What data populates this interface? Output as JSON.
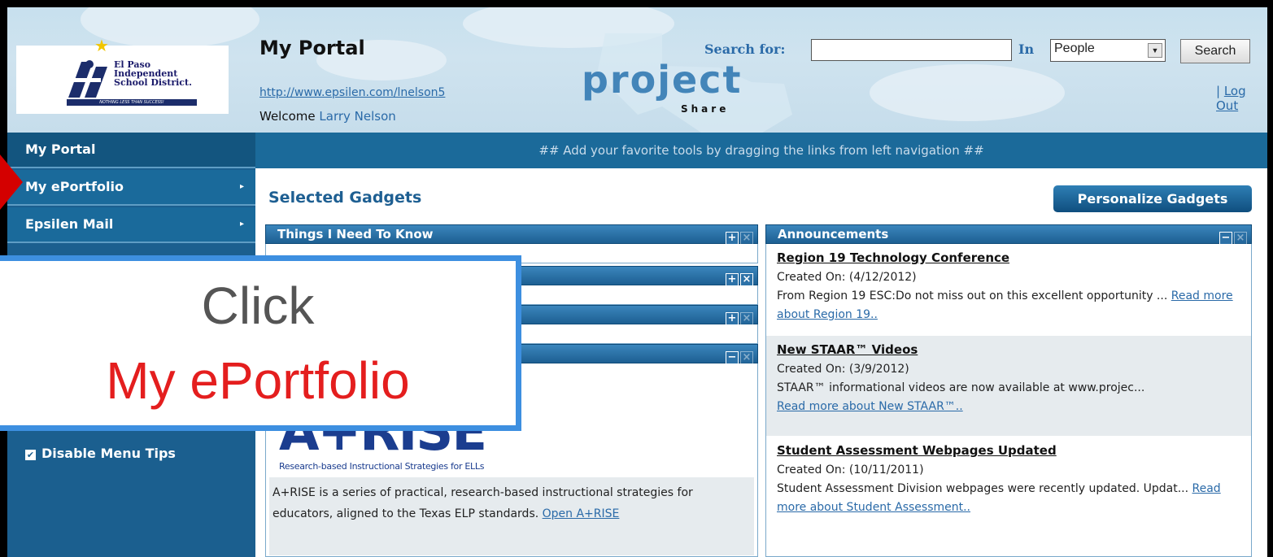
{
  "header": {
    "logo_lines": [
      "El Paso",
      "Independent",
      "School District."
    ],
    "logo_tagline": "NOTHING LESS THAN SUCCESS!",
    "title": "My Portal",
    "url": "http://www.epsilen.com/lnelson5",
    "welcome_prefix": "Welcome",
    "welcome_name": "Larry Nelson",
    "brand_word": "project",
    "brand_sub": "Share",
    "search_label": "Search for:",
    "search_value": "",
    "in_label": "In",
    "scope_selected": "People",
    "search_button": "Search",
    "logout_sep": "|",
    "logout": "Log Out"
  },
  "sidebar": {
    "items": [
      {
        "label": "My Portal"
      },
      {
        "label": "My ePortfolio"
      },
      {
        "label": "Epsilen Mail"
      }
    ],
    "disable_tips": "Disable Menu Tips"
  },
  "main": {
    "drag_hint": "## Add your favorite tools by dragging the links from left navigation ##",
    "selected_gadgets": "Selected Gadgets",
    "personalize_button": "Personalize Gadgets",
    "gadgets": [
      {
        "title": "Things I Need To Know"
      }
    ],
    "arise": {
      "logo": "A+RISE",
      "subtitle": "Research-based Instructional Strategies for ELLs",
      "desc": "A+RISE is a series of practical, research-based instructional strategies for educators, aligned to the Texas ELP standards.",
      "link": "Open A+RISE"
    },
    "announcements": {
      "title": "Announcements",
      "items": [
        {
          "title": "Region 19 Technology Conference",
          "created": "Created On: (4/12/2012)",
          "text": "From Region 19 ESC:Do not miss out on this excellent opportunity ...",
          "more": "Read more about Region 19.."
        },
        {
          "title": "New STAAR™ Videos",
          "created": "Created On: (3/9/2012)",
          "text": "STAAR™ informational videos are now available at www.projec...",
          "more": "Read more about New STAAR™.."
        },
        {
          "title": "Student Assessment Webpages Updated",
          "created": "Created On: (10/11/2011)",
          "text": "Student Assessment Division webpages were recently updated. Updat...",
          "more": "Read more about Student Assessment.."
        }
      ]
    }
  },
  "callout": {
    "line1": "Click",
    "line2": "My ePortfolio"
  },
  "colors": {
    "sidebar": "#1a6a9b",
    "accent": "#1e5f92",
    "callout_border": "#3d8fe0",
    "callout_red": "#e41e1e"
  }
}
